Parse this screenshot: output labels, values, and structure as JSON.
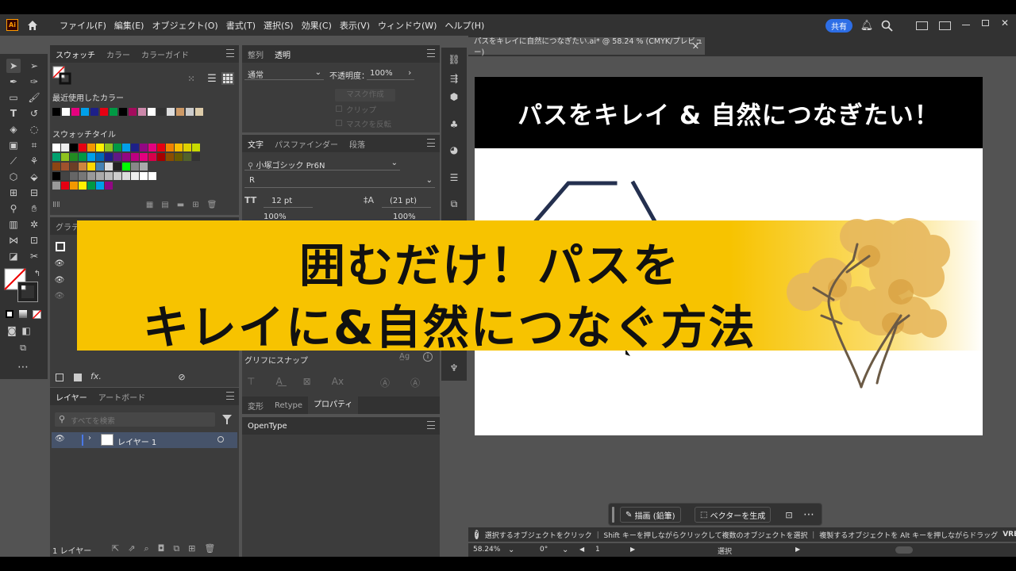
{
  "app": {
    "logo": "Ai",
    "share_label": "共有"
  },
  "menu": [
    "ファイル(F)",
    "編集(E)",
    "オブジェクト(O)",
    "書式(T)",
    "選択(S)",
    "効果(C)",
    "表示(V)",
    "ウィンドウ(W)",
    "ヘルプ(H)"
  ],
  "swatches_panel": {
    "tabs": [
      "スウォッチ",
      "カラー",
      "カラーガイド"
    ],
    "recent_label": "最近使用したカラー",
    "tile_label": "スウォッチタイル"
  },
  "transparency_panel": {
    "tabs": [
      "整列",
      "透明"
    ],
    "blend_mode": "通常",
    "opacity_label": "不透明度：",
    "opacity_value": "100%",
    "make_mask": "マスク作成",
    "clip": "クリップ",
    "invert_mask": "マスクを反転"
  },
  "character_panel": {
    "tabs": [
      "文字",
      "パスファインダー",
      "段落"
    ],
    "font_family": "小塚ゴシック Pr6N",
    "font_style": "R",
    "font_size": "12 pt",
    "leading": "(21 pt)",
    "h_scale": "100%",
    "v_scale": "100%",
    "snap_glyph": "グリフにスナップ"
  },
  "props_panel": {
    "tabs": [
      "変形",
      "Retype",
      "プロパティ"
    ]
  },
  "opentype_panel": {
    "tab": "OpenType"
  },
  "gradient_panel": {
    "tab": "グラデ"
  },
  "layers_panel": {
    "tabs": [
      "レイヤー",
      "アートボード"
    ],
    "search_placeholder": "すべてを検索",
    "layer_name": "レイヤー 1",
    "count": "1 レイヤー"
  },
  "document": {
    "tab_title": "パスをキレイに自然につなぎたい.ai* @ 58.24 % (CMYK/プレビュー)",
    "zoom": "58.24%",
    "rotation": "0°",
    "artboard_num": "1",
    "tool_name": "選択"
  },
  "artwork": {
    "title": "パスをキレイ & 自然につなぎたい！"
  },
  "banner": {
    "line1": "囲むだけ！パスを",
    "line2": "キレイに&自然につなぐ方法"
  },
  "context_bar": {
    "draw": "描画 (鉛筆)",
    "vector": "ベクターを生成"
  },
  "status": {
    "text": "選択するオブジェクトをクリック ｜ Shift キーを押しながらクリックして複数のオブジェクトを選択 ｜ 複製するオブジェクトを Alt キーを押しながらドラッグ",
    "watermark": "VREW"
  },
  "colors": {
    "accent": "#2d6ee6",
    "banner": "#f7c300",
    "panel": "#3c3c3c",
    "ui_dark": "#323232"
  }
}
